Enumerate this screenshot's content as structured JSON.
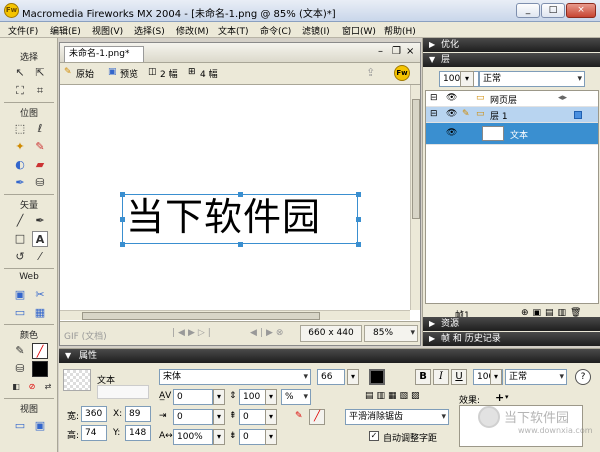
{
  "window": {
    "title": "Macromedia Fireworks MX 2004 - [未命名-1.png @  85% (文本)*]",
    "app_icon": "Fw",
    "btn_min": "_",
    "btn_max": "□",
    "btn_close": "×"
  },
  "menu": [
    "文件(F)",
    "编辑(E)",
    "视图(V)",
    "选择(S)",
    "修改(M)",
    "文本(T)",
    "命令(C)",
    "滤镜(I)",
    "窗口(W)",
    "帮助(H)"
  ],
  "toolbox": {
    "select": "选择",
    "bitmap": "位图",
    "vector": "矢量",
    "web": "Web",
    "colors": "颜色",
    "view": "视图"
  },
  "document": {
    "tab": "未命名-1.png*",
    "views": {
      "original": "原始",
      "preview": "预览",
      "two_up": "2 幅",
      "four_up": "4 幅"
    },
    "canvas_text": "当下软件园",
    "status": {
      "format": "GIF (文档)",
      "size": "660 x 440",
      "zoom": "85%"
    }
  },
  "panels": {
    "optimize": "优化",
    "layers": {
      "title": "层",
      "opacity": "100",
      "blend": "正常",
      "rows": [
        {
          "name": "网页层"
        },
        {
          "name": "层 1"
        },
        {
          "name": "文本"
        }
      ],
      "frame": "帧1"
    },
    "assets": "资源",
    "frames_history": "帧 和 历史记录"
  },
  "properties": {
    "title": "属性",
    "object_type": "文本",
    "font": "宋体",
    "size": "66",
    "kerning": "0",
    "leading": "100",
    "leading_unit": "%",
    "indent": "0",
    "space_before": "0",
    "space_after": "0",
    "horizontal_scale": "100%",
    "anti_alias": "平滑消除锯齿",
    "auto_kern": "自动调整字距",
    "width_label": "宽:",
    "width": "360",
    "height_label": "高:",
    "height": "74",
    "x_label": "X:",
    "x": "89",
    "y_label": "Y:",
    "y": "148",
    "opacity": "100",
    "blend": "正常",
    "effects_label": "效果:",
    "bold": "B",
    "italic": "I",
    "underline": "U",
    "text_color": "#000000"
  },
  "watermark": {
    "text": "当下软件园",
    "url": "www.downxia.com"
  }
}
